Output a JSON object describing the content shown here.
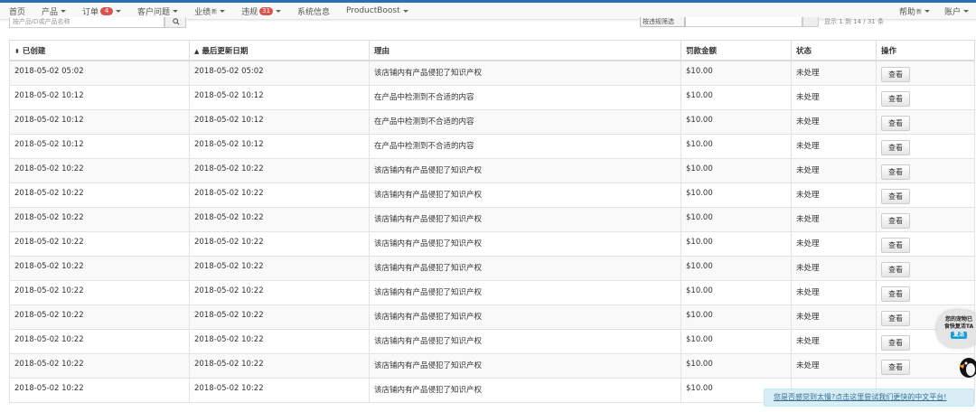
{
  "nav": {
    "left": [
      {
        "label": "首页",
        "caret": false
      },
      {
        "label": "产品",
        "caret": true
      },
      {
        "label": "订单",
        "badge": "4",
        "caret": true
      },
      {
        "label": "客户问题",
        "caret": true
      },
      {
        "label": "业绩",
        "caret": true,
        "sup": "新"
      },
      {
        "label": "违规",
        "badge": "31",
        "caret": true
      },
      {
        "label": "系统信息",
        "caret": false
      },
      {
        "label": "ProductBoost",
        "caret": true
      }
    ],
    "right": [
      {
        "label": "帮助",
        "sup": "新",
        "caret": true
      },
      {
        "label": "账户",
        "caret": true
      }
    ]
  },
  "filters": {
    "search_placeholder": "按产品ID或产品名称",
    "select_value": "按违规筛选",
    "tail_text": "显示 1 到 14 / 31 条"
  },
  "table": {
    "columns": [
      "已创建",
      "最后更新日期",
      "理由",
      "罚款金额",
      "状态",
      "操作"
    ],
    "sort_icons": {
      "created": "⬍",
      "updated": "▲"
    },
    "rows": [
      {
        "created": "2018-05-02 05:02",
        "updated": "2018-05-02 05:02",
        "reason": "该店铺内有产品侵犯了知识产权",
        "fine": "$10.00",
        "status": "未处理",
        "action": "查看"
      },
      {
        "created": "2018-05-02 10:12",
        "updated": "2018-05-02 10:12",
        "reason": "在产品中检测到不合适的内容",
        "fine": "$10.00",
        "status": "未处理",
        "action": "查看"
      },
      {
        "created": "2018-05-02 10:12",
        "updated": "2018-05-02 10:12",
        "reason": "在产品中检测到不合适的内容",
        "fine": "$10.00",
        "status": "未处理",
        "action": "查看"
      },
      {
        "created": "2018-05-02 10:12",
        "updated": "2018-05-02 10:12",
        "reason": "在产品中检测到不合适的内容",
        "fine": "$10.00",
        "status": "未处理",
        "action": "查看"
      },
      {
        "created": "2018-05-02 10:22",
        "updated": "2018-05-02 10:22",
        "reason": "该店铺内有产品侵犯了知识产权",
        "fine": "$10.00",
        "status": "未处理",
        "action": "查看"
      },
      {
        "created": "2018-05-02 10:22",
        "updated": "2018-05-02 10:22",
        "reason": "该店铺内有产品侵犯了知识产权",
        "fine": "$10.00",
        "status": "未处理",
        "action": "查看"
      },
      {
        "created": "2018-05-02 10:22",
        "updated": "2018-05-02 10:22",
        "reason": "该店铺内有产品侵犯了知识产权",
        "fine": "$10.00",
        "status": "未处理",
        "action": "查看"
      },
      {
        "created": "2018-05-02 10:22",
        "updated": "2018-05-02 10:22",
        "reason": "该店铺内有产品侵犯了知识产权",
        "fine": "$10.00",
        "status": "未处理",
        "action": "查看"
      },
      {
        "created": "2018-05-02 10:22",
        "updated": "2018-05-02 10:22",
        "reason": "该店铺内有产品侵犯了知识产权",
        "fine": "$10.00",
        "status": "未处理",
        "action": "查看"
      },
      {
        "created": "2018-05-02 10:22",
        "updated": "2018-05-02 10:22",
        "reason": "该店铺内有产品侵犯了知识产权",
        "fine": "$10.00",
        "status": "未处理",
        "action": "查看"
      },
      {
        "created": "2018-05-02 10:22",
        "updated": "2018-05-02 10:22",
        "reason": "该店铺内有产品侵犯了知识产权",
        "fine": "$10.00",
        "status": "未处理",
        "action": "查看"
      },
      {
        "created": "2018-05-02 10:22",
        "updated": "2018-05-02 10:22",
        "reason": "该店铺内有产品侵犯了知识产权",
        "fine": "$10.00",
        "status": "未处理",
        "action": "查看"
      },
      {
        "created": "2018-05-02 10:22",
        "updated": "2018-05-02 10:22",
        "reason": "该店铺内有产品侵犯了知识产权",
        "fine": "$10.00",
        "status": "未处理",
        "action": "查看"
      },
      {
        "created": "2018-05-02 10:22",
        "updated": "2018-05-02 10:22",
        "reason": "该店铺内有产品侵犯了知识产权",
        "fine": "$10.00",
        "status": "",
        "action": ""
      }
    ]
  },
  "promo": {
    "text": "您是否感觉到太慢?点击这里尝试我们更快的中文平台!"
  },
  "bubble": {
    "line1": "您的宠物已",
    "line2": "食快复活TA",
    "tag": "复活"
  },
  "colors": {
    "accent": "#2a6fb3",
    "badge": "#d9534f",
    "promo_bg": "#d9edf7"
  }
}
